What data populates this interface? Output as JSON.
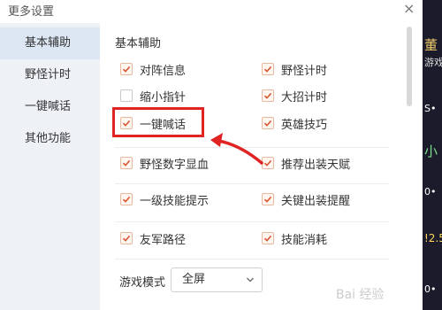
{
  "window": {
    "title": "更多设置",
    "close": "×"
  },
  "sidebar": {
    "items": [
      {
        "label": "基本辅助",
        "active": true
      },
      {
        "label": "野怪计时",
        "active": false
      },
      {
        "label": "一键喊话",
        "active": false
      },
      {
        "label": "其他功能",
        "active": false
      }
    ]
  },
  "main": {
    "section_title": "基本辅助",
    "options": [
      {
        "label": "对阵信息",
        "checked": true
      },
      {
        "label": "野怪计时",
        "checked": true
      },
      {
        "label": "缩小指针",
        "checked": false
      },
      {
        "label": "大招计时",
        "checked": true
      },
      {
        "label": "一键喊话",
        "checked": true
      },
      {
        "label": "英雄技巧",
        "checked": true
      },
      {
        "label": "野怪数字显血",
        "checked": true
      },
      {
        "label": "推荐出装天赋",
        "checked": true
      },
      {
        "label": "一级技能提示",
        "checked": true
      },
      {
        "label": "关键出装提醒",
        "checked": true
      },
      {
        "label": "友军路径",
        "checked": true
      },
      {
        "label": "技能消耗",
        "checked": true
      }
    ],
    "mode": {
      "label": "游戏模式",
      "value": "全屏"
    }
  },
  "colors": {
    "highlight": "#e02424",
    "checkbox_border": "#e8b9a1",
    "check": "#d9542c"
  },
  "background_strip": {
    "texts": [
      "董",
      "游戏",
      "S•",
      "小",
      "0•",
      "!2.5",
      "0•"
    ]
  },
  "watermark": "Bai 经验"
}
